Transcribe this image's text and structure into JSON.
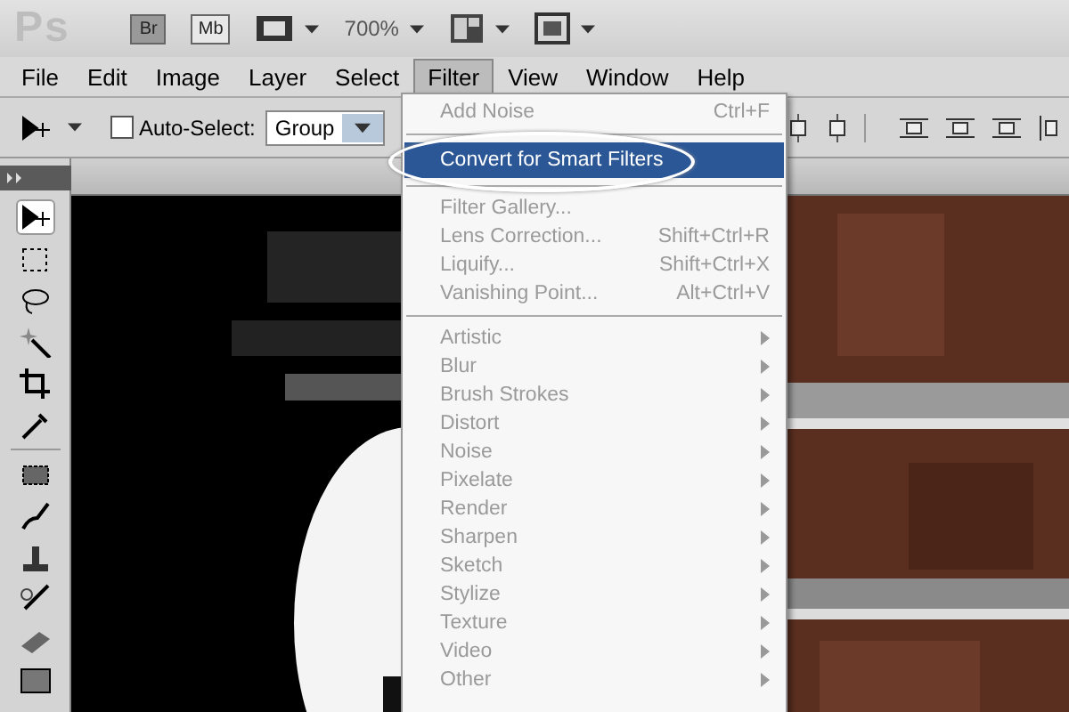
{
  "app_bar": {
    "logo": "Ps",
    "bridge_button": "Br",
    "mini_bridge_button": "Mb",
    "zoom": "700%"
  },
  "menu_bar": [
    {
      "label": "File",
      "selected": false
    },
    {
      "label": "Edit",
      "selected": false
    },
    {
      "label": "Image",
      "selected": false
    },
    {
      "label": "Layer",
      "selected": false
    },
    {
      "label": "Select",
      "selected": false
    },
    {
      "label": "Filter",
      "selected": true
    },
    {
      "label": "View",
      "selected": false
    },
    {
      "label": "Window",
      "selected": false
    },
    {
      "label": "Help",
      "selected": false
    }
  ],
  "options_bar": {
    "auto_select": {
      "label": "Auto-Select:",
      "checked": false
    },
    "auto_select_target": "Group"
  },
  "filter_menu": {
    "items": [
      {
        "kind": "command",
        "label": "Add Noise",
        "shortcut": "Ctrl+F",
        "disabled": true,
        "selected": false
      },
      {
        "kind": "separator"
      },
      {
        "kind": "command",
        "label": "Convert for Smart Filters",
        "disabled": false,
        "selected": true
      },
      {
        "kind": "separator"
      },
      {
        "kind": "command",
        "label": "Filter Gallery...",
        "disabled": true,
        "selected": false
      },
      {
        "kind": "command",
        "label": "Lens Correction...",
        "shortcut": "Shift+Ctrl+R",
        "disabled": true,
        "selected": false
      },
      {
        "kind": "command",
        "label": "Liquify...",
        "shortcut": "Shift+Ctrl+X",
        "disabled": true,
        "selected": false
      },
      {
        "kind": "command",
        "label": "Vanishing Point...",
        "shortcut": "Alt+Ctrl+V",
        "disabled": true,
        "selected": false
      },
      {
        "kind": "separator"
      },
      {
        "kind": "submenu",
        "label": "Artistic",
        "disabled": true,
        "selected": false
      },
      {
        "kind": "submenu",
        "label": "Blur",
        "disabled": true,
        "selected": false
      },
      {
        "kind": "submenu",
        "label": "Brush Strokes",
        "disabled": true,
        "selected": false
      },
      {
        "kind": "submenu",
        "label": "Distort",
        "disabled": true,
        "selected": false
      },
      {
        "kind": "submenu",
        "label": "Noise",
        "disabled": true,
        "selected": false
      },
      {
        "kind": "submenu",
        "label": "Pixelate",
        "disabled": true,
        "selected": false
      },
      {
        "kind": "submenu",
        "label": "Render",
        "disabled": true,
        "selected": false
      },
      {
        "kind": "submenu",
        "label": "Sharpen",
        "disabled": true,
        "selected": false
      },
      {
        "kind": "submenu",
        "label": "Sketch",
        "disabled": true,
        "selected": false
      },
      {
        "kind": "submenu",
        "label": "Stylize",
        "disabled": true,
        "selected": false
      },
      {
        "kind": "submenu",
        "label": "Texture",
        "disabled": true,
        "selected": false
      },
      {
        "kind": "submenu",
        "label": "Video",
        "disabled": true,
        "selected": false
      },
      {
        "kind": "submenu",
        "label": "Other",
        "disabled": true,
        "selected": false
      }
    ]
  }
}
